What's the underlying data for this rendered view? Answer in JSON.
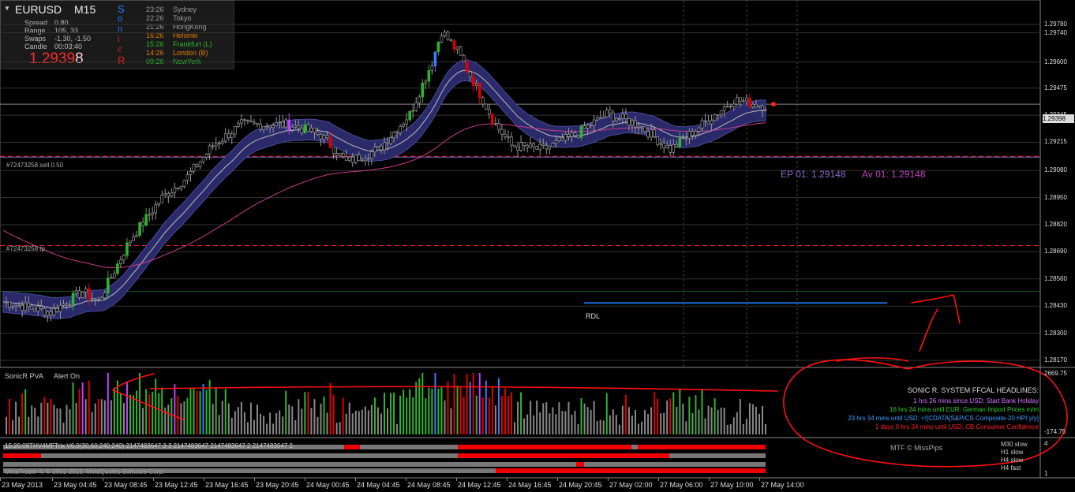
{
  "panel": {
    "symbol": "EURUSD",
    "timeframe": "M15",
    "spread_label": "Spread",
    "spread_value": "0.80",
    "range_label": "Range",
    "range_value": "105, 33",
    "swaps_label": "Swaps",
    "swaps_value": "-1.30, -1.50",
    "candle_label": "Candle",
    "candle_value": "00:03:40",
    "price_main": "1.2939",
    "price_last": "8",
    "sonic_letters": [
      "S",
      "o",
      "n",
      "i",
      "c",
      "R"
    ],
    "sessions": [
      {
        "time": "23:26",
        "name": "Sydney",
        "color": "#999999"
      },
      {
        "time": "22:26",
        "name": "Tokyo",
        "color": "#999999"
      },
      {
        "time": "21:26",
        "name": "HongKong",
        "color": "#999999"
      },
      {
        "time": "16:26",
        "name": "Helsinki",
        "color": "#e07a00"
      },
      {
        "time": "15:26",
        "name": "Frankfurt  (L)",
        "color": "#2fb52f"
      },
      {
        "time": "14:26",
        "name": "London  (B)",
        "color": "#e07a00"
      },
      {
        "time": "09:26",
        "name": "NewYork",
        "color": "#2fb52f"
      }
    ]
  },
  "price_axis": [
    {
      "label": "1.29780",
      "price": 1.2978
    },
    {
      "label": "1.29740",
      "price": 1.2974
    },
    {
      "label": "1.29600",
      "price": 1.296
    },
    {
      "label": "1.29475",
      "price": 1.29475
    },
    {
      "label": "1.29345",
      "price": 1.29345
    },
    {
      "label": "1.29215",
      "price": 1.29215
    },
    {
      "label": "1.29080",
      "price": 1.2908
    },
    {
      "label": "1.28950",
      "price": 1.2895
    },
    {
      "label": "1.28820",
      "price": 1.2882
    },
    {
      "label": "1.28690",
      "price": 1.2869
    },
    {
      "label": "1.28560",
      "price": 1.2856
    },
    {
      "label": "1.28430",
      "price": 1.2843
    },
    {
      "label": "1.28300",
      "price": 1.283
    },
    {
      "label": "1.28170",
      "price": 1.2817
    }
  ],
  "current_price": "1.29398",
  "orders": {
    "sell_label": "#72473258 sell 0.50",
    "tp_label": "#72473258 tp",
    "ep_label": "EP 01:  1.29148",
    "av_label": "Av 01:  1.29148",
    "rdl_label": "RDL"
  },
  "indicator": {
    "title": "SonicR PVA",
    "alert": "Alert On",
    "top_value": "2669.75",
    "bottom_value": "-174.75"
  },
  "ffcal": {
    "title": "SONIC R. SYSTEM  FFCAL HEADLINES:",
    "items": [
      {
        "text": "1 hrs 26 mins since USD: Start Bank Holiday",
        "color": "#d070ff"
      },
      {
        "text": "16 hrs 34 mins until EUR: German Import Prices m/m",
        "color": "#2fd02f"
      },
      {
        "text": "23 hrs 34 mins until USD: <![CDATA[S&P/CS Composite-20 HPI y/y]",
        "color": "#3aa0ff"
      },
      {
        "text": "1 days 0 hrs 34 mins until USD: CB Consumer Confidence",
        "color": "#ff2020"
      }
    ]
  },
  "trix": {
    "title": "15:26:08THV4MFTrix V6.0(30,60,240,240) 2147483647 3 3 2147483647 2147483647 2 2147483647 2",
    "copyright": "MetaTrader 4, © 2001-2013, MetaQuotes Software Corp.",
    "mtf": "MTF © MissPips",
    "rows": [
      {
        "label": "M30 slow"
      },
      {
        "label": "H1 slow"
      },
      {
        "label": "H4 slow"
      },
      {
        "label": "H4 fast"
      }
    ],
    "scale_top": "4",
    "scale_bottom": "1"
  },
  "time_axis": [
    "23 May 2013",
    "23 May 04:45",
    "23 May 08:45",
    "23 May 12:45",
    "23 May 16:45",
    "23 May 20:45",
    "24 May 00:45",
    "24 May 04:45",
    "24 May 08:45",
    "24 May 12:45",
    "24 May 16:45",
    "24 May 20:45",
    "27 May 02:00",
    "27 May 06:00",
    "27 May 10:00",
    "27 May 14:00"
  ],
  "colors": {
    "bull": "#2fb52f",
    "bear": "#e00000",
    "band": "#2a2a6a",
    "pink": "#c83c8c",
    "level_red": "#ff2020",
    "rdl": "#1a6ad8",
    "annot": "#ff1010"
  }
}
